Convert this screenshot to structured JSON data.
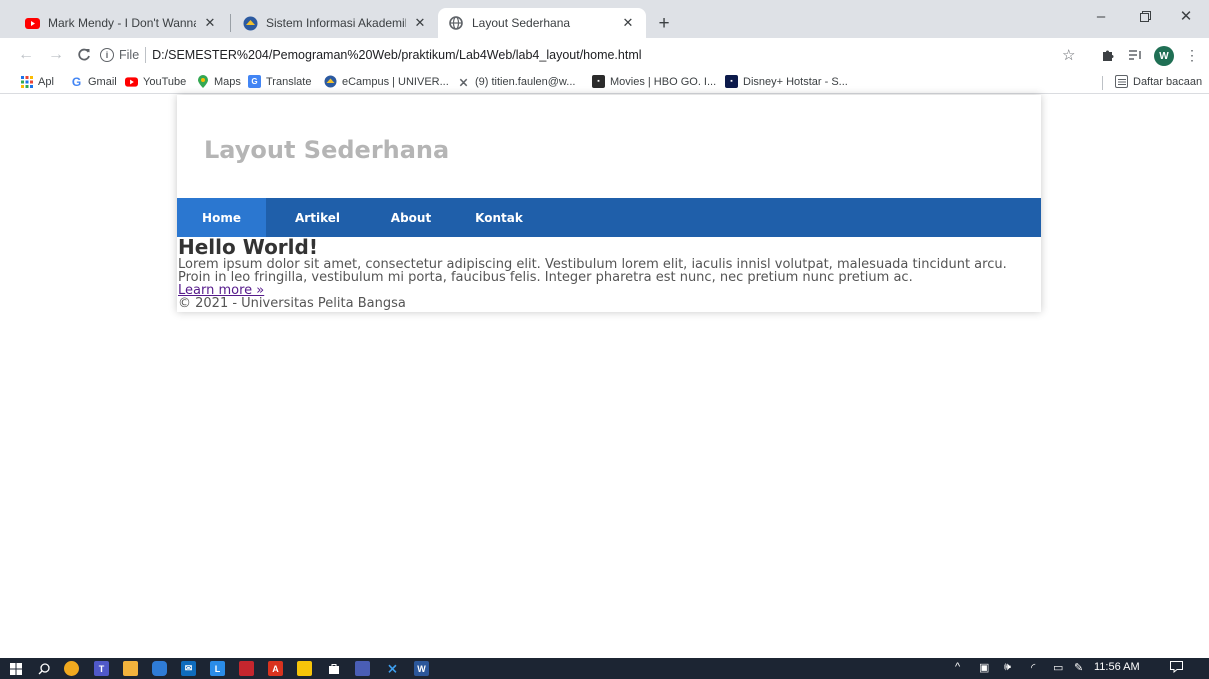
{
  "browser": {
    "tabs": [
      {
        "title": "Mark Mendy - I Don't Wanna Be",
        "favicon": "youtube-icon",
        "active": false
      },
      {
        "title": "Sistem Informasi Akademik",
        "favicon": "campus-icon",
        "active": false
      },
      {
        "title": "Layout Sederhana",
        "favicon": "globe-icon",
        "active": true
      }
    ],
    "address": {
      "scheme_label": "File",
      "url": "D:/SEMESTER%204/Pemograman%20Web/praktikum/Lab4Web/lab4_layout/home.html"
    },
    "profile_initial": "W",
    "bookmarks": [
      {
        "label": "Apl",
        "icon": "apps-grid-icon"
      },
      {
        "label": "Gmail",
        "icon": "google-icon"
      },
      {
        "label": "YouTube",
        "icon": "youtube-icon"
      },
      {
        "label": "Maps",
        "icon": "maps-pin-icon"
      },
      {
        "label": "Translate",
        "icon": "translate-icon"
      },
      {
        "label": "eCampus | UNIVER...",
        "icon": "campus-icon"
      },
      {
        "label": "(9) titien.faulen@w...",
        "icon": "mail-x-icon"
      },
      {
        "label": "Movies | HBO GO. I...",
        "icon": "hbo-icon"
      },
      {
        "label": "Disney+ Hotstar - S...",
        "icon": "hotstar-icon"
      }
    ],
    "reading_list": "Daftar bacaan",
    "colors": {
      "tabstrip": "#dee1e6",
      "accent": "#1a73e8"
    }
  },
  "site": {
    "title": "Layout Sederhana",
    "nav": [
      {
        "label": "Home",
        "active": true
      },
      {
        "label": "Artikel",
        "active": false
      },
      {
        "label": "About",
        "active": false
      },
      {
        "label": "Kontak",
        "active": false
      }
    ],
    "heading": "Hello World!",
    "body": "Lorem ipsum dolor sit amet, consectetur adipiscing elit. Vestibulum lorem elit, iaculis innisl volutpat, malesuada tincidunt arcu. Proin in leo fringilla, vestibulum mi porta, faucibus felis. Integer pharetra est nunc, nec pretium nunc pretium ac.",
    "link": "Learn more »",
    "footer": "© 2021 - Universitas Pelita Bangsa",
    "colors": {
      "nav_bg": "#1f5faa",
      "nav_active": "#2b77d0",
      "title": "#b5b5b5"
    }
  },
  "taskbar": {
    "time": "11:56 AM"
  }
}
